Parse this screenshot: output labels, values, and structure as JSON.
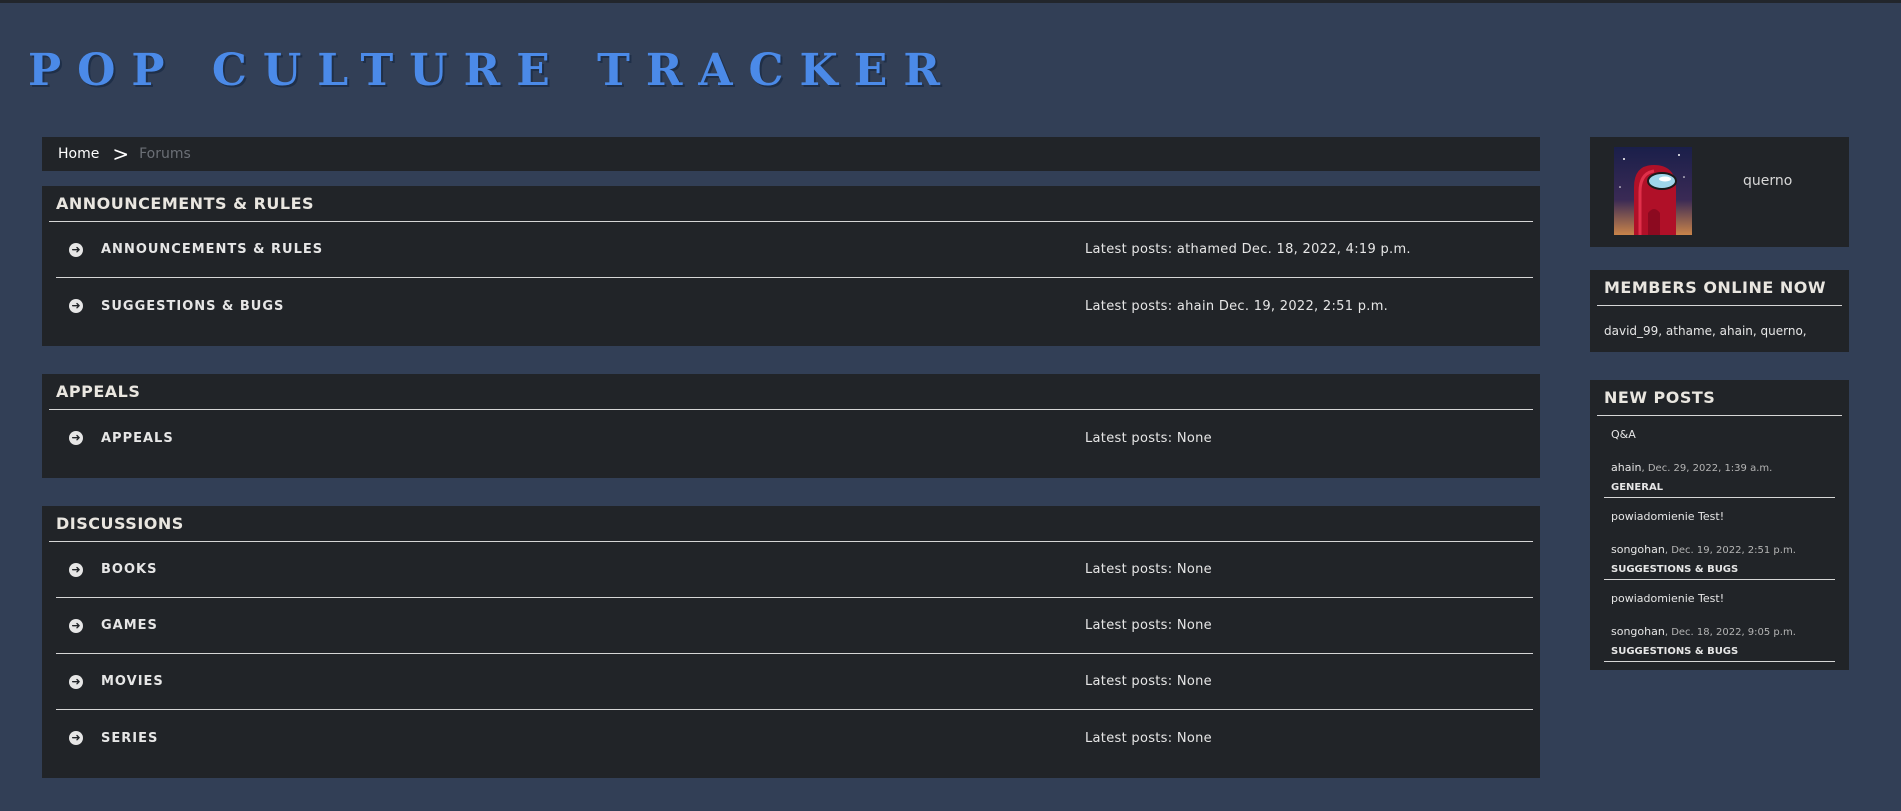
{
  "site": {
    "title": "POP CULTURE TRACKER"
  },
  "breadcrumb": {
    "home": "Home",
    "separator": ">",
    "current": "Forums"
  },
  "sections": [
    {
      "title": "ANNOUNCEMENTS & RULES",
      "forums": [
        {
          "name": "ANNOUNCEMENTS & RULES",
          "latest": "Latest posts: athamed Dec. 18, 2022, 4:19 p.m."
        },
        {
          "name": "SUGGESTIONS & BUGS",
          "latest": "Latest posts: ahain Dec. 19, 2022, 2:51 p.m."
        }
      ]
    },
    {
      "title": "APPEALS",
      "forums": [
        {
          "name": "APPEALS",
          "latest": "Latest posts: None"
        }
      ]
    },
    {
      "title": "DISCUSSIONS",
      "forums": [
        {
          "name": "BOOKS",
          "latest": "Latest posts: None"
        },
        {
          "name": "GAMES",
          "latest": "Latest posts: None"
        },
        {
          "name": "MOVIES",
          "latest": "Latest posts: None"
        },
        {
          "name": "SERIES",
          "latest": "Latest posts: None"
        }
      ]
    }
  ],
  "sidebar": {
    "user": {
      "name": "querno"
    },
    "members_online": {
      "title": "MEMBERS ONLINE NOW",
      "list": "david_99, athame, ahain, querno,"
    },
    "new_posts": {
      "title": "NEW POSTS",
      "items": [
        {
          "title": "Q&A",
          "author": "ahain",
          "date": ", Dec. 29, 2022, 1:39 a.m.",
          "category": "GENERAL"
        },
        {
          "title": "powiadomienie Test!",
          "author": "songohan",
          "date": ", Dec. 19, 2022, 2:51 p.m.",
          "category": "SUGGESTIONS & BUGS"
        },
        {
          "title": "powiadomienie Test!",
          "author": "songohan",
          "date": ", Dec. 18, 2022, 9:05 p.m.",
          "category": "SUGGESTIONS & BUGS"
        }
      ]
    }
  },
  "icons": {
    "forum_row": "arrow-circle-right-icon",
    "avatar": "red-crewmate-avatar"
  },
  "colors": {
    "background": "#323f56",
    "panel": "#212428",
    "title_accent": "#4b8ae8"
  }
}
